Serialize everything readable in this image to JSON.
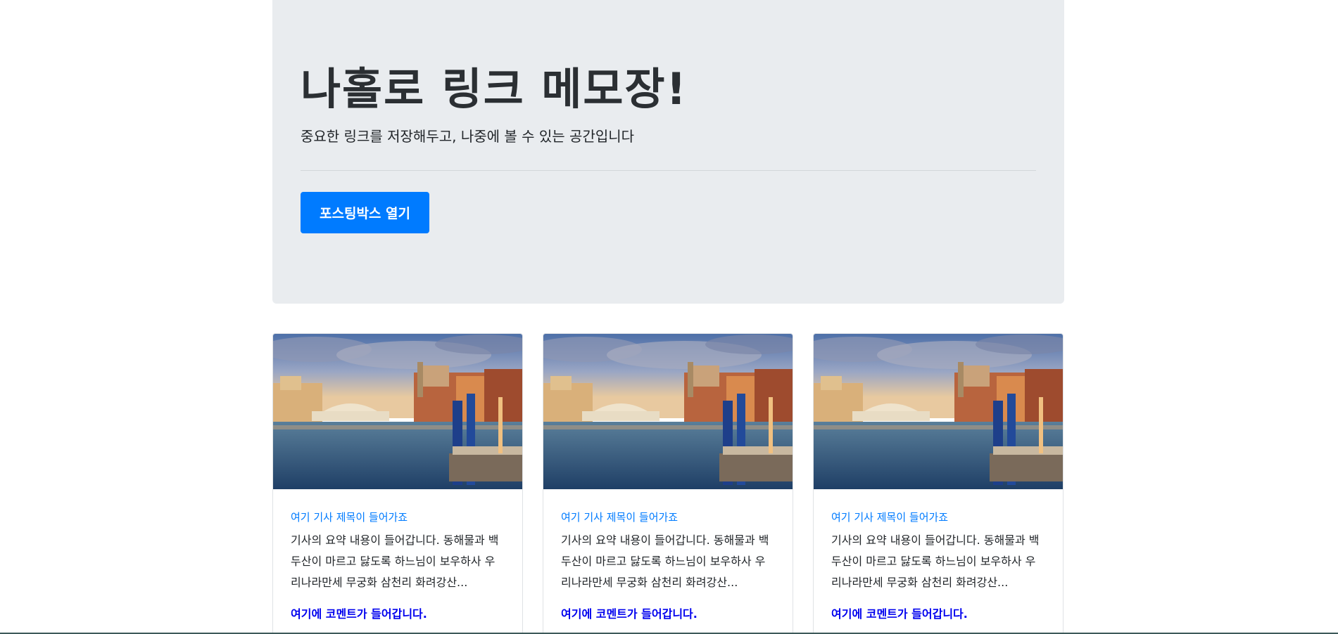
{
  "jumbotron": {
    "title": "나홀로 링크 메모장!",
    "lead": "중요한 링크를 저장해두고, 나중에 볼 수 있는 공간입니다",
    "button_label": "포스팅박스 열기"
  },
  "cards": [
    {
      "title": "여기 기사 제목이 들어가죠",
      "summary": "기사의 요약 내용이 들어갑니다. 동해물과 백두산이 마르고 닳도록 하느님이 보우하사 우리나라만세 무궁화 삼천리 화려강산...",
      "comment": "여기에 코멘트가 들어갑니다."
    },
    {
      "title": "여기 기사 제목이 들어가죠",
      "summary": "기사의 요약 내용이 들어갑니다. 동해물과 백두산이 마르고 닳도록 하느님이 보우하사 우리나라만세 무궁화 삼천리 화려강산...",
      "comment": "여기에 코멘트가 들어갑니다."
    },
    {
      "title": "여기 기사 제목이 들어가죠",
      "summary": "기사의 요약 내용이 들어갑니다. 동해물과 백두산이 마르고 닳도록 하느님이 보우하사 우리나라만세 무궁화 삼천리 화려강산...",
      "comment": "여기에 코멘트가 들어갑니다."
    }
  ],
  "colors": {
    "jumbotron_bg": "#e9ecef",
    "primary": "#007bff",
    "comment": "#0000ee",
    "text": "#212529"
  }
}
